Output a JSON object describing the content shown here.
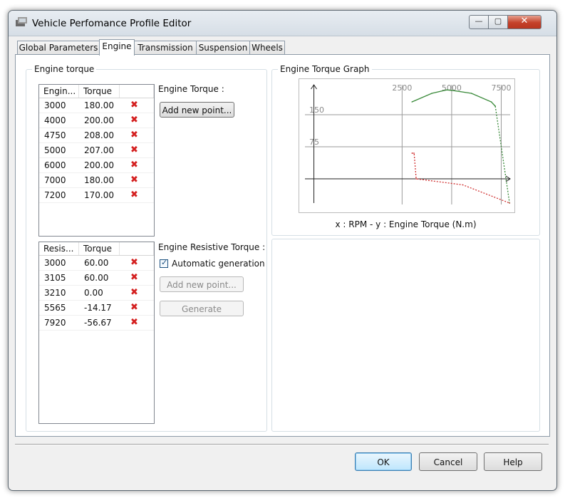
{
  "window": {
    "title": "Vehicle Perfomance Profile Editor"
  },
  "title_buttons": {
    "minimize": "—",
    "maximize": "▢",
    "close": "✕"
  },
  "tabs": [
    "Global Parameters",
    "Engine",
    "Transmission",
    "Suspension",
    "Wheels"
  ],
  "active_tab": "Engine",
  "engine_torque": {
    "group_label": "Engine torque",
    "columns": [
      "Engin...",
      "Torque"
    ],
    "rows": [
      [
        "3000",
        "180.00"
      ],
      [
        "4000",
        "200.00"
      ],
      [
        "4750",
        "208.00"
      ],
      [
        "5000",
        "207.00"
      ],
      [
        "6000",
        "200.00"
      ],
      [
        "7000",
        "180.00"
      ],
      [
        "7200",
        "170.00"
      ]
    ],
    "section_label": "Engine Torque :",
    "add_button": "Add new point..."
  },
  "resistive_torque": {
    "columns": [
      "Resis...",
      "Torque"
    ],
    "rows": [
      [
        "3000",
        "60.00"
      ],
      [
        "3105",
        "60.00"
      ],
      [
        "3210",
        "0.00"
      ],
      [
        "5565",
        "-14.17"
      ],
      [
        "7920",
        "-56.67"
      ]
    ],
    "section_label": "Engine Resistive Torque :",
    "auto_checkbox_label": "Automatic generation",
    "auto_checked": true,
    "add_button": "Add new point...",
    "generate_button": "Generate"
  },
  "graph": {
    "group_label": "Engine Torque Graph",
    "caption": "x : RPM - y : Engine Torque (N.m)",
    "x_ticks": [
      "2500",
      "5000",
      "7500"
    ],
    "y_ticks": [
      "150",
      "75"
    ]
  },
  "chart_data": {
    "type": "line",
    "xlabel": "",
    "ylabel": "",
    "xlim": [
      -2400,
      7950
    ],
    "ylim": [
      -60,
      220
    ],
    "x_ticks": [
      2500,
      5000,
      7500
    ],
    "y_ticks": [
      75,
      150
    ],
    "series": [
      {
        "x": [
          3000,
          4000,
          4750,
          5000,
          6000,
          7000,
          7200
        ],
        "y": [
          180,
          200,
          208,
          207,
          200,
          180,
          170
        ],
        "color": "#3a8a3a",
        "style": "solid"
      },
      {
        "x": [
          7200,
          7920
        ],
        "y": [
          170,
          -56.67
        ],
        "color": "#3a8a3a",
        "style": "dotted"
      },
      {
        "x": [
          3000,
          3105,
          3210,
          5565,
          7920
        ],
        "y": [
          60,
          60,
          0,
          -14.17,
          -56.67
        ],
        "color": "#d03030",
        "style": "dotted"
      }
    ]
  },
  "dialog_buttons": {
    "ok": "OK",
    "cancel": "Cancel",
    "help": "Help"
  },
  "colors": {
    "delete_icon": "#d42020",
    "torque_line": "#3a8a3a",
    "resistive_line": "#d03030"
  }
}
